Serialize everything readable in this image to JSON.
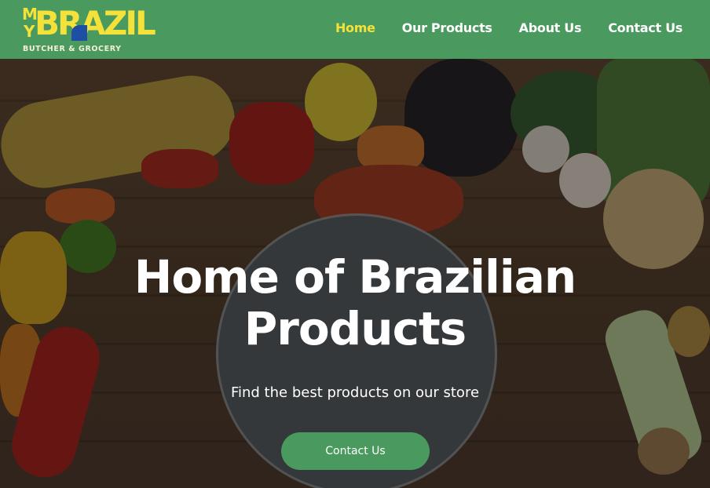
{
  "logo": {
    "my_m": "M",
    "my_y": "Y",
    "brazil": "BRAZIL",
    "tagline": "BUTCHER & GROCERY"
  },
  "nav": {
    "items": [
      {
        "label": "Home",
        "active": true
      },
      {
        "label": "Our Products",
        "active": false
      },
      {
        "label": "About Us",
        "active": false
      },
      {
        "label": "Contact Us",
        "active": false
      }
    ]
  },
  "hero": {
    "title_line1": "Home of Brazilian",
    "title_line2": "Products",
    "subtitle": "Find the best products on our store",
    "button_label": "Contact Us"
  },
  "colors": {
    "header_green": "#4a9a5f",
    "active_yellow": "#f4e13a",
    "button_green": "#4a9a5f"
  }
}
